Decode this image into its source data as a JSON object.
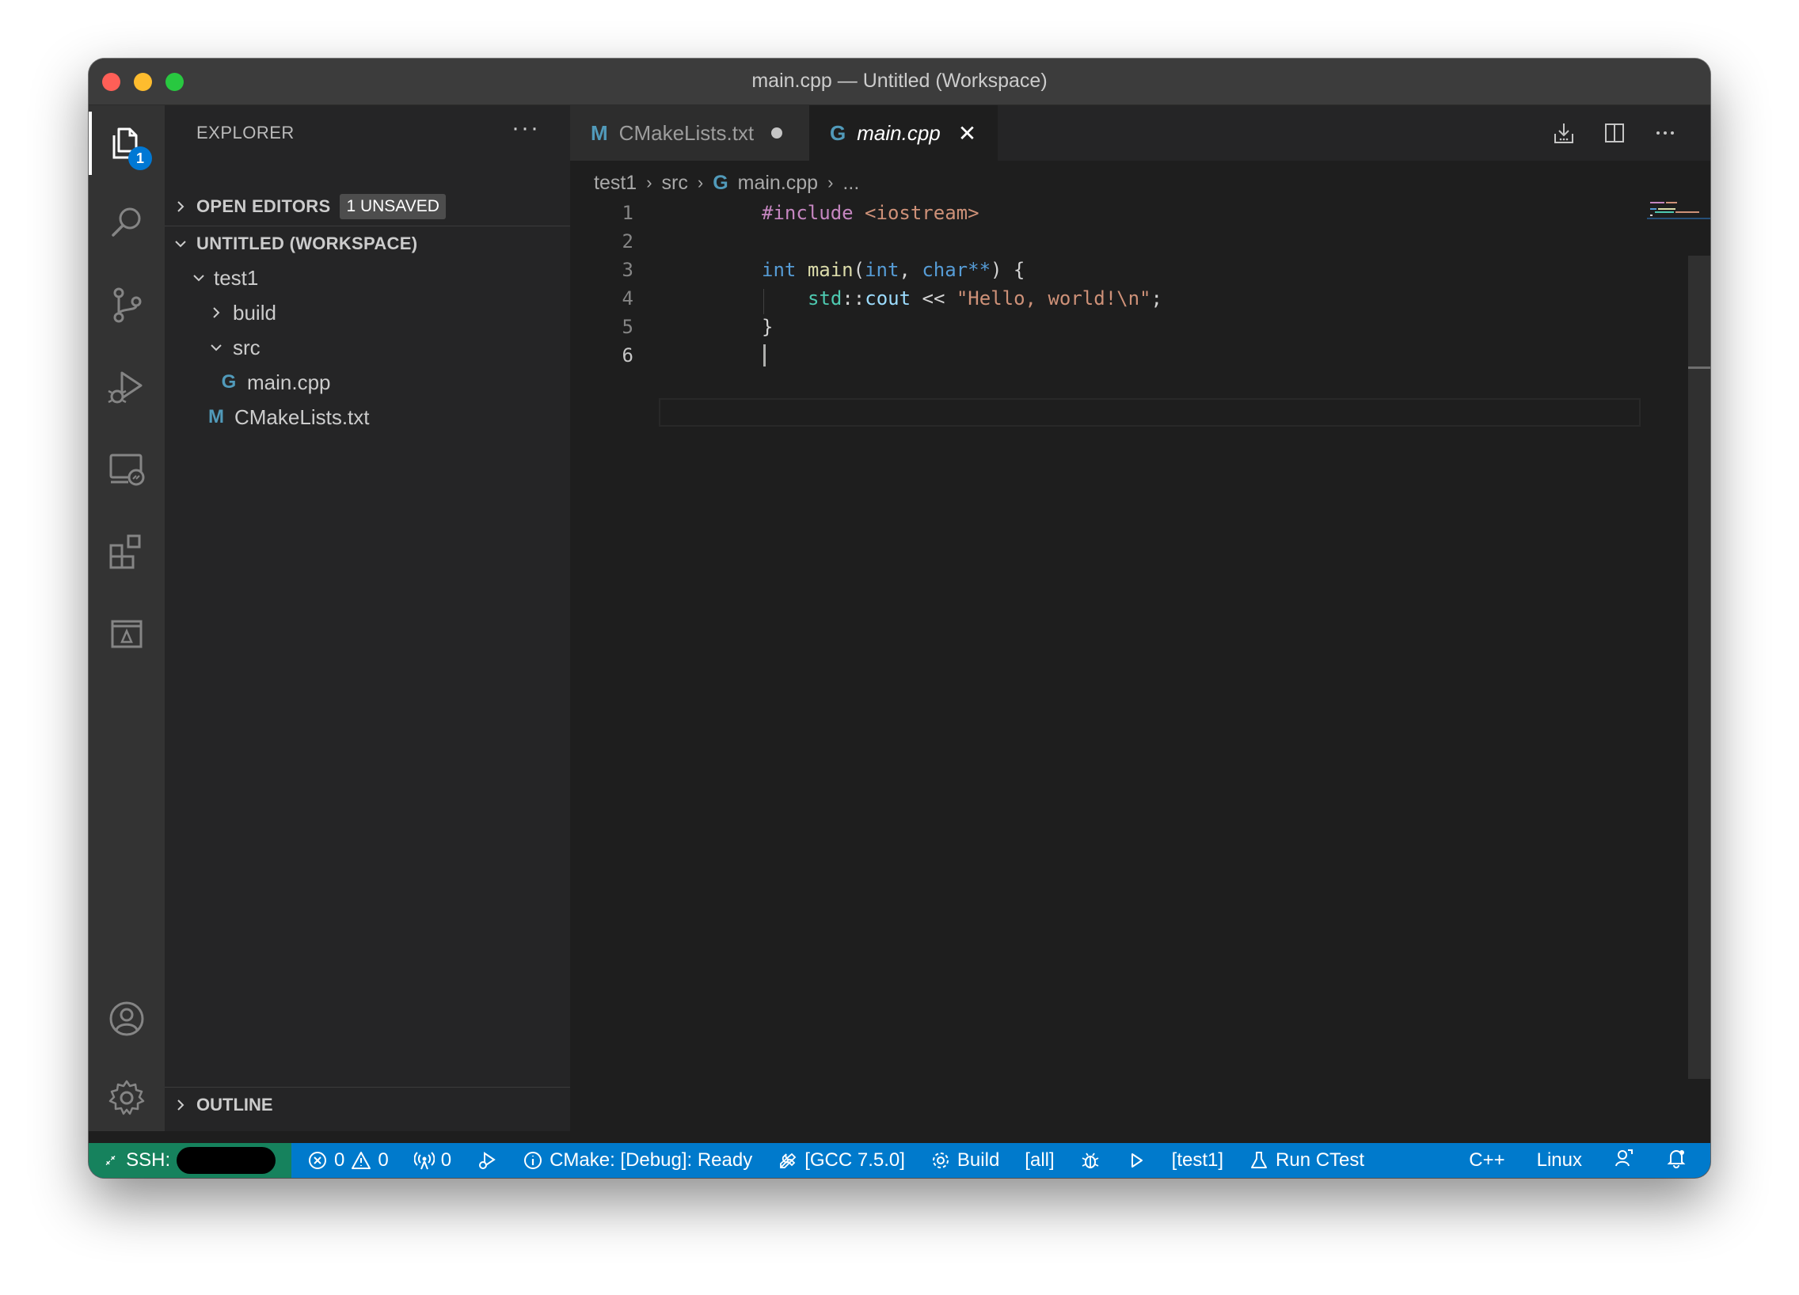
{
  "window": {
    "title": "main.cpp — Untitled (Workspace)"
  },
  "activity": {
    "explorer_badge": "1"
  },
  "sidebar": {
    "title": "EXPLORER",
    "more": "···",
    "open_editors": {
      "label": "OPEN EDITORS",
      "badge": "1 UNSAVED"
    },
    "workspace": {
      "label": "UNTITLED (WORKSPACE)"
    },
    "tree": [
      {
        "label": "test1"
      },
      {
        "label": "build"
      },
      {
        "label": "src"
      },
      {
        "label": "main.cpp"
      },
      {
        "label": "CMakeLists.txt"
      }
    ],
    "outline": {
      "label": "OUTLINE"
    }
  },
  "tabs": [
    {
      "label": "CMakeLists.txt",
      "icon": "M",
      "state": "unsaved"
    },
    {
      "label": "main.cpp",
      "icon": "G",
      "state": "active"
    }
  ],
  "breadcrumb": {
    "part1": "test1",
    "part2": "src",
    "part3": "main.cpp",
    "part4": "..."
  },
  "editor": {
    "line_numbers": [
      "1",
      "2",
      "3",
      "4",
      "5",
      "6"
    ],
    "code": {
      "l1_include": "#include",
      "l1_header": "<iostream>",
      "l3_int": "int",
      "l3_main": "main",
      "l3_p1": "(",
      "l3_int2": "int",
      "l3_comma": ",",
      "l3_char": "char",
      "l3_ptr": "**",
      "l3_close": ") {",
      "l4_std": "std",
      "l4_colons": "::",
      "l4_cout": "cout",
      "l4_op": " << ",
      "l4_str": "\"Hello, world!\\n\"",
      "l4_semi": ";",
      "l5_brace": "}"
    }
  },
  "status": {
    "remote": "SSH:",
    "errors": "0",
    "warnings": "0",
    "ports": "0",
    "cmake_status": "CMake: [Debug]: Ready",
    "kit": "[GCC 7.5.0]",
    "build": "Build",
    "target": "[all]",
    "launch_target": "[test1]",
    "ctest": "Run CTest",
    "language": "C++",
    "os": "Linux"
  },
  "colors": {
    "statusbar": "#007acc",
    "remote": "#16825d",
    "badge": "#0078d4"
  }
}
